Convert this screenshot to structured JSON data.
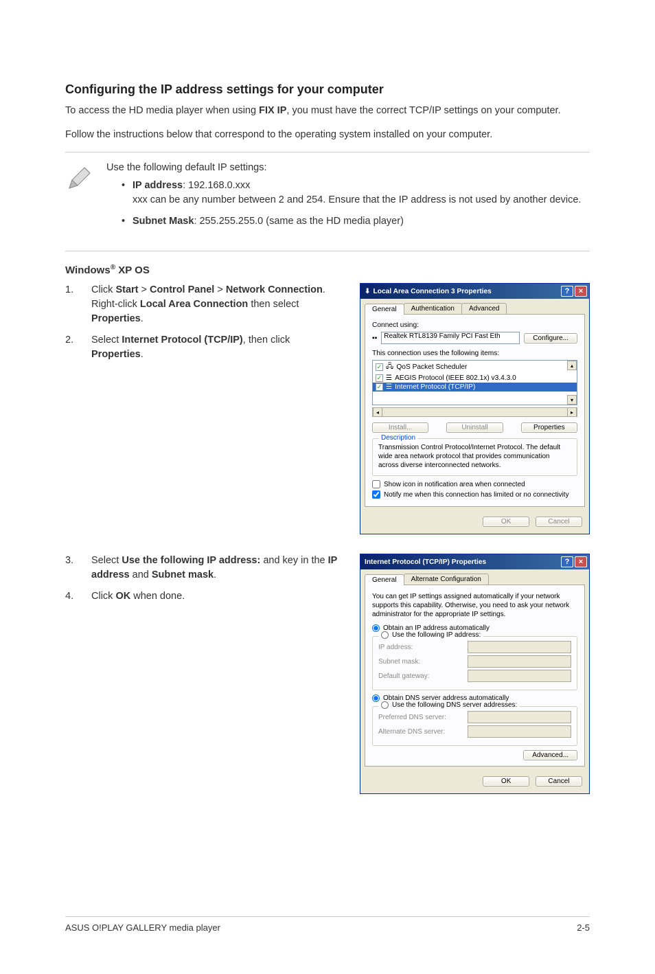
{
  "heading": "Configuring the IP address settings for your computer",
  "intro1_a": "To access the HD media player when using ",
  "intro1_b": "FIX IP",
  "intro1_c": ", you must have the correct TCP/IP settings on your computer.",
  "intro2": "Follow the instructions below that correspond to the operating system installed on your computer.",
  "note_lead": "Use the following default IP settings:",
  "note_ip_label": "IP address",
  "note_ip_value": ": 192.168.0.xxx",
  "note_ip_desc": "xxx can be any number between 2 and 254. Ensure that the IP address is not used by another device.",
  "note_mask_label": "Subnet Mask",
  "note_mask_value": ": 255.255.255.0 (same as the HD media player)",
  "os_header_a": "Windows",
  "os_header_b": " XP OS",
  "step1_a": "Click ",
  "step1_b": "Start",
  "step1_c": " > ",
  "step1_d": "Control Panel",
  "step1_e": " > ",
  "step1_f": "Network Connection",
  "step1_g": ". Right-click ",
  "step1_h": "Local Area Connection",
  "step1_i": " then select ",
  "step1_j": "Properties",
  "step1_k": ".",
  "step2_a": "Select ",
  "step2_b": "Internet Protocol (TCP/IP)",
  "step2_c": ", then click ",
  "step2_d": "Properties",
  "step2_e": ".",
  "step3_a": "Select ",
  "step3_b": "Use the following IP address:",
  "step3_c": " and key in the ",
  "step3_d": "IP address",
  "step3_e": " and ",
  "step3_f": "Subnet mask",
  "step3_g": ".",
  "step4_a": "Click ",
  "step4_b": "OK",
  "step4_c": " when done.",
  "dlg1": {
    "title": "Local Area Connection 3 Properties",
    "tabs": [
      "General",
      "Authentication",
      "Advanced"
    ],
    "connect_using": "Connect using:",
    "adapter": "Realtek RTL8139 Family PCI Fast Eth",
    "configure": "Configure...",
    "items_label": "This connection uses the following items:",
    "items": [
      "QoS Packet Scheduler",
      "AEGIS Protocol (IEEE 802.1x) v3.4.3.0",
      "Internet Protocol (TCP/IP)"
    ],
    "install": "Install...",
    "uninstall": "Uninstall",
    "properties": "Properties",
    "desc_label": "Description",
    "desc_text": "Transmission Control Protocol/Internet Protocol. The default wide area network protocol that provides communication across diverse interconnected networks.",
    "chk1": "Show icon in notification area when connected",
    "chk2": "Notify me when this connection has limited or no connectivity",
    "ok": "OK",
    "cancel": "Cancel"
  },
  "dlg2": {
    "title": "Internet Protocol (TCP/IP) Properties",
    "tabs": [
      "General",
      "Alternate Configuration"
    ],
    "desc": "You can get IP settings assigned automatically if your network supports this capability. Otherwise, you need to ask your network administrator for the appropriate IP settings.",
    "r1": "Obtain an IP address automatically",
    "r2": "Use the following IP address:",
    "ip_label": "IP address:",
    "mask_label": "Subnet mask:",
    "gw_label": "Default gateway:",
    "r3": "Obtain DNS server address automatically",
    "r4": "Use the following DNS server addresses:",
    "dns1_label": "Preferred DNS server:",
    "dns2_label": "Alternate DNS server:",
    "advanced": "Advanced...",
    "ok": "OK",
    "cancel": "Cancel"
  },
  "footer_left": "ASUS O!PLAY GALLERY media player",
  "footer_right": "2-5"
}
